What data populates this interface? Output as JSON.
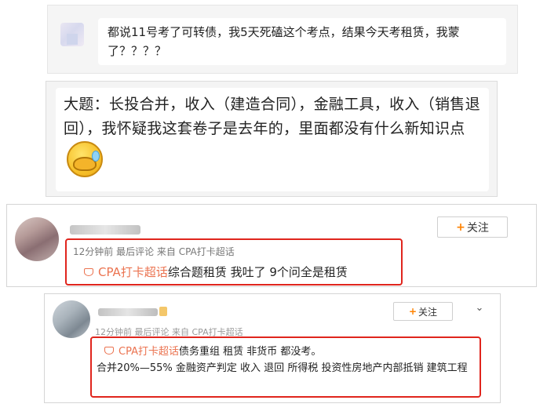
{
  "panel1": {
    "message": "都说11号考了可转债，我5天死磕这个考点，结果今天考租赁，我蒙了？？？？"
  },
  "panel2": {
    "message": "大题：长投合并，收入（建造合同），金融工具，收入（销售退回），我怀疑我这套卷子是去年的，里面都没有什么新知识点"
  },
  "comment1": {
    "follow_label": "关注",
    "meta": "12分钟前 最后评论 来自 CPA打卡超话",
    "topic": "CPA打卡超话",
    "text": "综合题租赁  我吐了 9个问全是租赁"
  },
  "comment2": {
    "follow_label": "关注",
    "meta": "12分钟前 最后评论 来自 CPA打卡超话",
    "topic": "CPA打卡超话",
    "text_line1": "债务重组 租赁 非货币  都没考。",
    "text_line2": "合并20%—55%  金融资产判定  收入  退回   所得税  投资性房地产内部抵销   建筑工程"
  },
  "icons": {
    "follow_plus": "plus-icon",
    "topic_gem": "super-topic-icon",
    "more": "chevron-down-icon",
    "emoji": "laughing-crying-emoji"
  },
  "colors": {
    "accent": "#ff8200",
    "topic": "#eb7350",
    "highlight_box": "#e0251d"
  }
}
